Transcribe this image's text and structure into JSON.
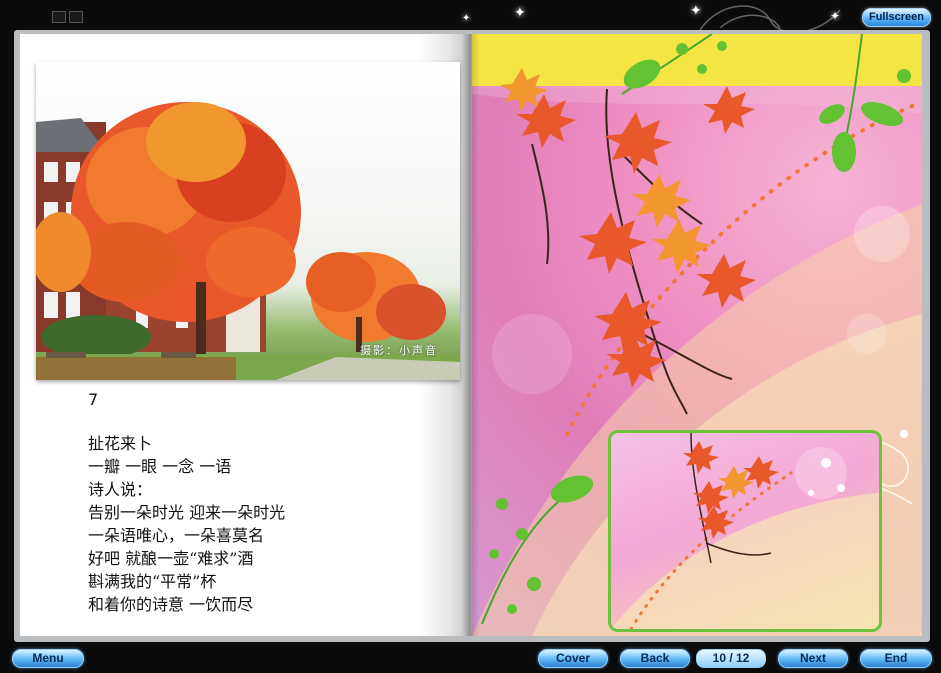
{
  "toolbar": {
    "fullscreen_label": "Fullscreen",
    "menu_label": "Menu",
    "cover_label": "Cover",
    "back_label": "Back",
    "next_label": "Next",
    "end_label": "End",
    "page_indicator": "10 / 12"
  },
  "left_page": {
    "photo_credit": "摄影：小声音",
    "page_number": "7",
    "poem_lines": [
      "扯花来卜",
      "一瓣 一眼 一念 一语",
      "诗人说：",
      "告别一朵时光 迎来一朵时光",
      "一朵语唯心，一朵喜莫名",
      "好吧 就酿一壶“难求”酒",
      "斟满我的“平常”杯",
      "和着你的诗意 一饮而尽"
    ]
  },
  "colors": {
    "button_blue": "#67bdf8",
    "yellow_band": "#f5f300",
    "pink_background": "#ef8fc2",
    "frame_green": "#6cc23a",
    "leaf_orange": "#e8582a"
  },
  "icons": [
    "window-control-icon",
    "sparkle-icon",
    "maple-leaf-icon",
    "vine-icon"
  ]
}
